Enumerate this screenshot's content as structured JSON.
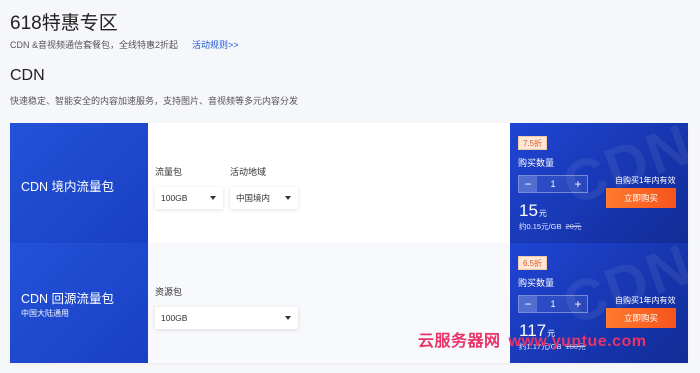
{
  "header": {
    "title": "618特惠专区",
    "subtitle": "CDN &音视频通信套餐包，全线特惠2折起",
    "rules_link": "活动规则>>"
  },
  "section": {
    "title": "CDN",
    "subtitle": "快速稳定、智能安全的内容加速服务，支持图片、音视频等多元内容分发"
  },
  "products": [
    {
      "name": "CDN 境内流量包",
      "note": "",
      "options": [
        {
          "label": "流量包",
          "value": "100GB"
        },
        {
          "label": "活动地域",
          "value": "中国境内"
        }
      ],
      "discount": "7.5折",
      "qty_label": "购买数量",
      "qty": "1",
      "minus": "−",
      "plus": "+",
      "price": "15",
      "price_unit": "元",
      "unit_price": "约0.15元/GB",
      "orig_price": "20元",
      "valid_note": "自购买1年内有效",
      "buy_label": "立即购买"
    },
    {
      "name": "CDN 回源流量包",
      "note": "中国大陆通用",
      "options": [
        {
          "label": "资源包",
          "value": "100GB"
        }
      ],
      "discount": "6.5折",
      "qty_label": "购买数量",
      "qty": "1",
      "minus": "−",
      "plus": "+",
      "price": "117",
      "price_unit": "元",
      "unit_price": "约1.17元/GB",
      "orig_price": "180元",
      "valid_note": "自购买1年内有效",
      "buy_label": "立即购买"
    }
  ],
  "decor_text": "CDN",
  "watermark": {
    "part1": "云服务器网",
    "part2": "www.yuntue.com"
  }
}
